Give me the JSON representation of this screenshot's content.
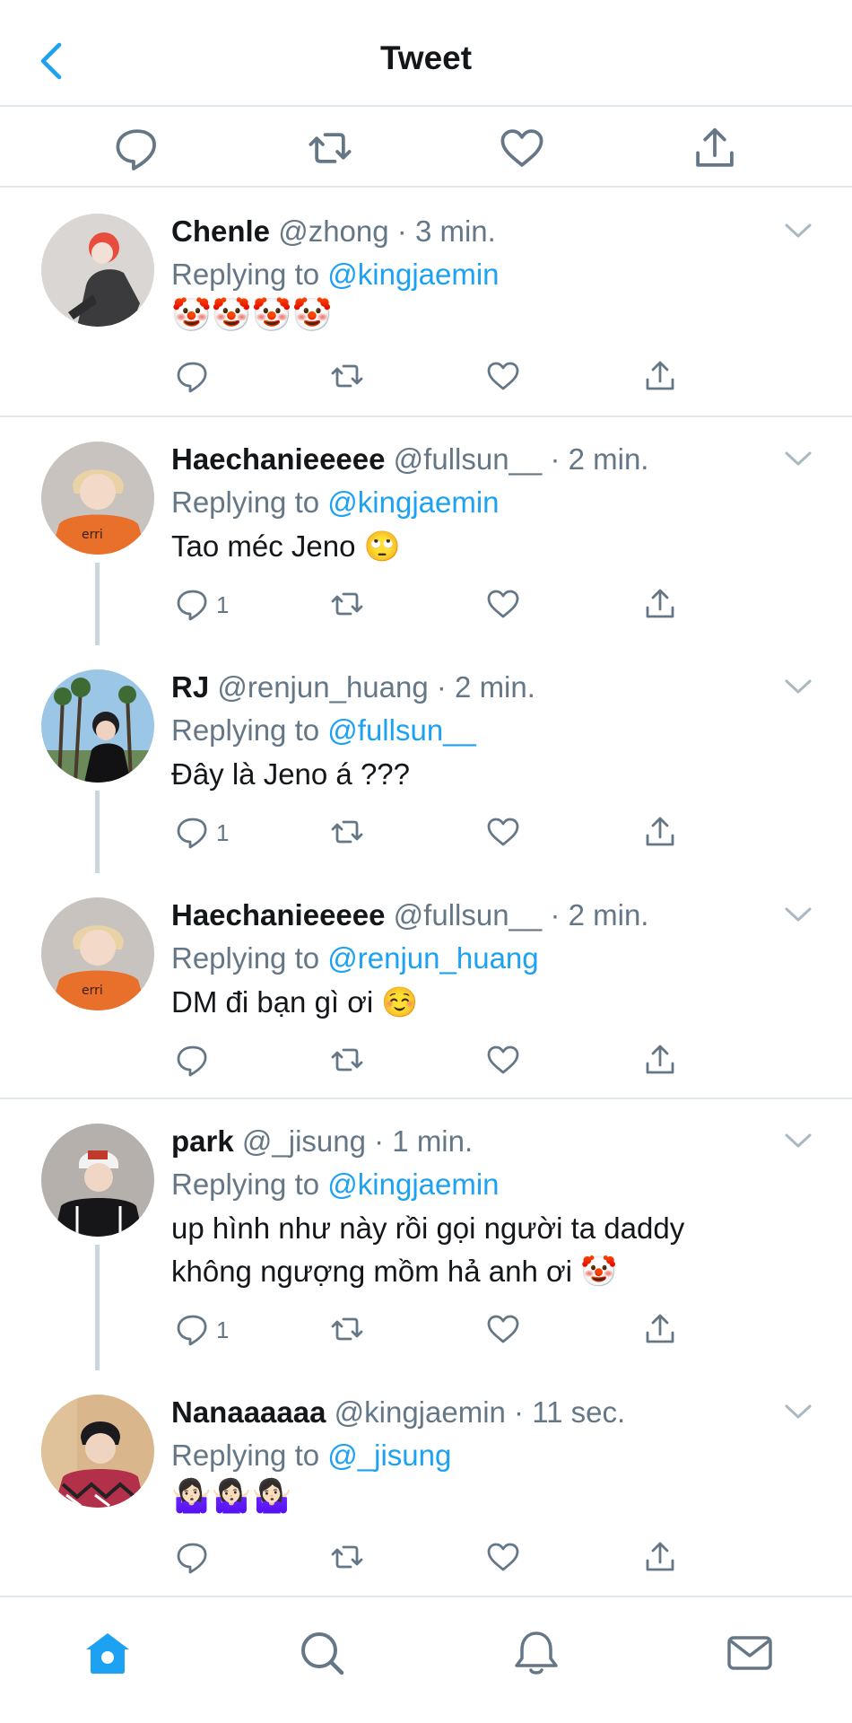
{
  "header": {
    "title": "Tweet"
  },
  "colors": {
    "accent": "#1da1f2",
    "muted": "#657786",
    "divider": "#e1e8ed",
    "thread": "#ccd6dd"
  },
  "action_bar": {
    "icons": [
      "reply-icon",
      "retweet-icon",
      "like-icon",
      "share-icon"
    ]
  },
  "tweets": [
    {
      "name": "Chenle",
      "handle": "@zhong",
      "time": "3 min.",
      "replying_label": "Replying to",
      "reply_to": "@kingjaemin",
      "body": "🤡🤡🤡🤡",
      "reply_count": ""
    },
    {
      "name": "Haechanieeeee",
      "handle": "@fullsun__",
      "time": "2 min.",
      "replying_label": "Replying to",
      "reply_to": "@kingjaemin",
      "body": "Tao méc Jeno 🙄",
      "reply_count": "1"
    },
    {
      "name": "RJ",
      "handle": "@renjun_huang",
      "time": "2 min.",
      "replying_label": "Replying to",
      "reply_to": "@fullsun__",
      "body": "Đây là Jeno á ???",
      "reply_count": "1"
    },
    {
      "name": "Haechanieeeee",
      "handle": "@fullsun__",
      "time": "2 min.",
      "replying_label": "Replying to",
      "reply_to": "@renjun_huang",
      "body": "DM đi bạn gì ơi ☺️",
      "reply_count": ""
    },
    {
      "name": "park",
      "handle": "@_jisung",
      "time": "1 min.",
      "replying_label": "Replying to",
      "reply_to": "@kingjaemin",
      "body_lines": [
        "up hình như này rồi gọi người ta daddy",
        "không ngượng mồm hả anh ơi 🤡"
      ],
      "reply_count": "1"
    },
    {
      "name": "Nanaaaaaa",
      "handle": "@kingjaemin",
      "time": "11 sec.",
      "replying_label": "Replying to",
      "reply_to": "@_jisung",
      "body": "🤷🏻‍♀️🤷🏻‍♀️🤷🏻‍♀️",
      "reply_count": ""
    }
  ],
  "tabbar": {
    "icons": [
      "home-icon",
      "search-icon",
      "notifications-icon",
      "messages-icon"
    ]
  }
}
